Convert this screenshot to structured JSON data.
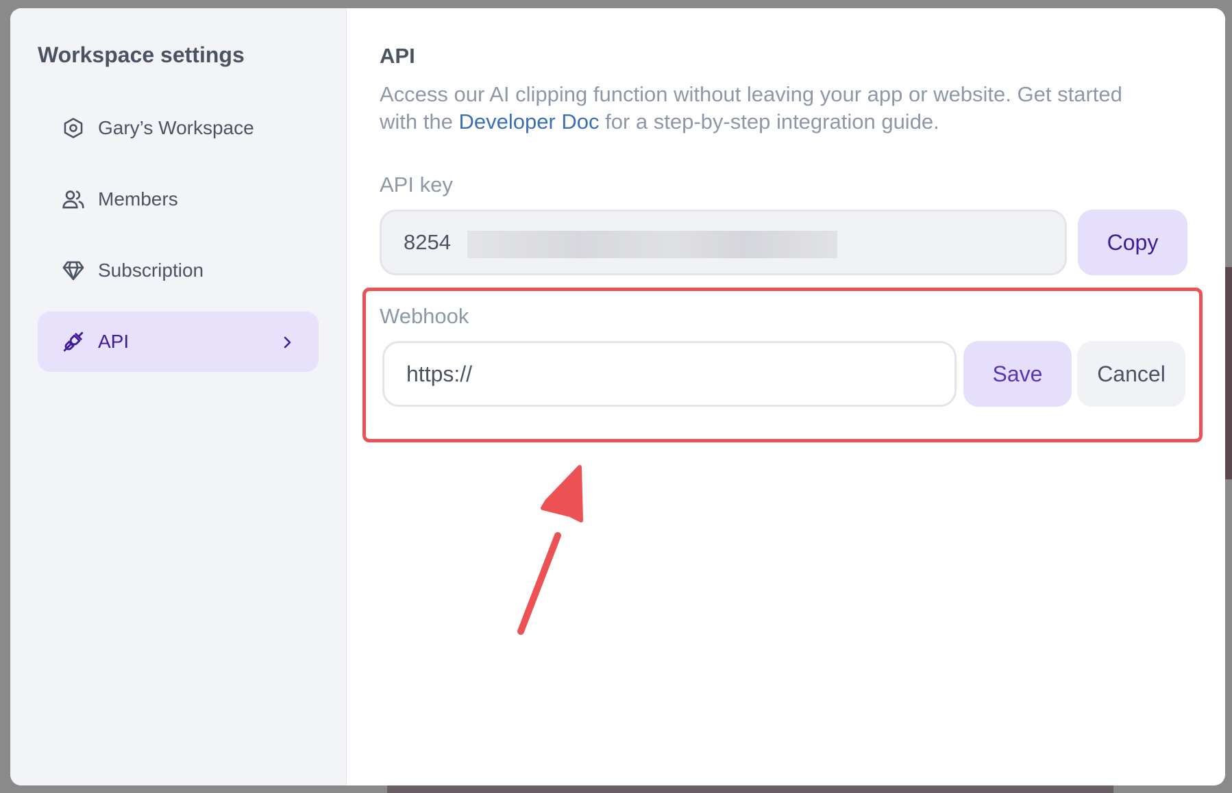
{
  "sidebar": {
    "title": "Workspace settings",
    "items": [
      {
        "label": "Gary’s Workspace",
        "icon": "workspace-icon"
      },
      {
        "label": "Members",
        "icon": "users-icon"
      },
      {
        "label": "Subscription",
        "icon": "diamond-icon"
      },
      {
        "label": "API",
        "icon": "plug-icon",
        "active": true
      }
    ]
  },
  "main": {
    "title": "API",
    "description_before": "Access our AI clipping function without leaving your app or website. Get started with the ",
    "description_link": "Developer Doc",
    "description_after": " for a step-by-step integration guide.",
    "api_key_label": "API key",
    "api_key_value": "8254",
    "copy_label": "Copy",
    "webhook_label": "Webhook",
    "webhook_value": "https://",
    "save_label": "Save",
    "cancel_label": "Cancel"
  },
  "colors": {
    "accent": "#3f1b9a",
    "accent_bg": "#e6dffb",
    "annotation": "#ec5254"
  }
}
